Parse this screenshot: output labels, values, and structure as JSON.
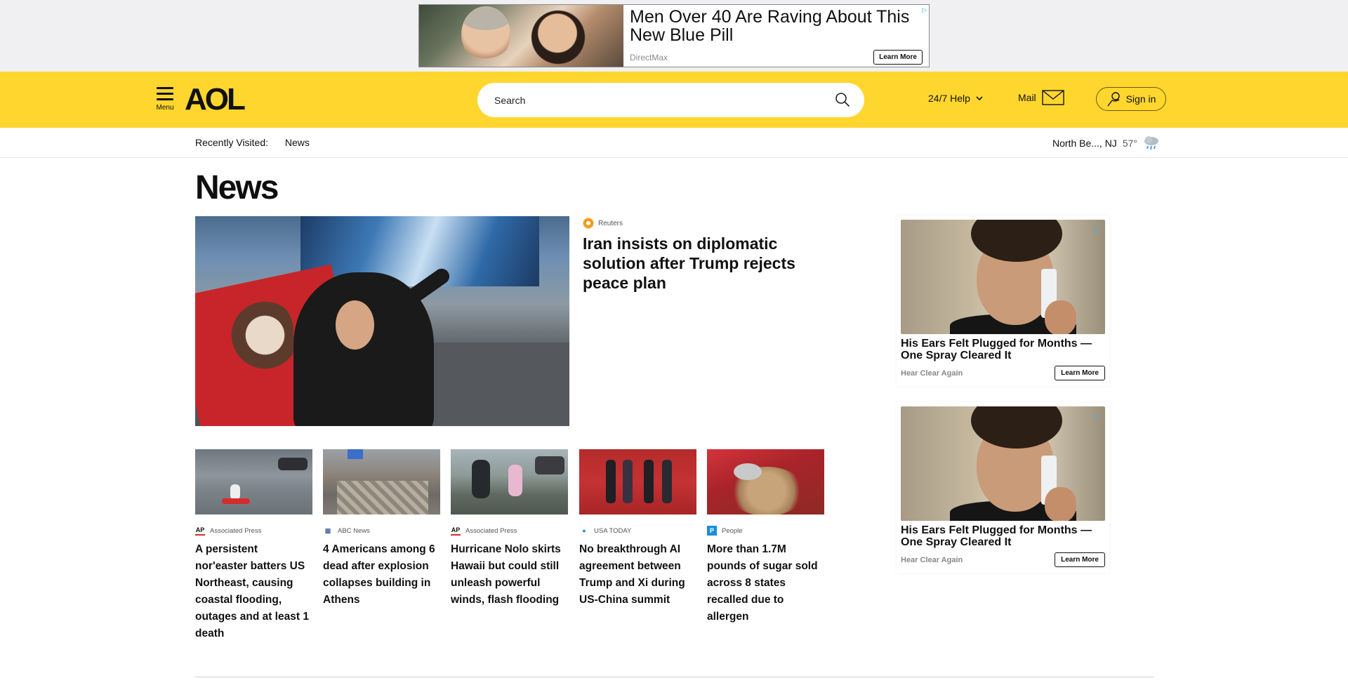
{
  "top_ad": {
    "headline": "Men Over 40 Are Raving About This New Blue Pill",
    "brand": "DirectMax",
    "cta": "Learn More"
  },
  "header": {
    "menu_label": "Menu",
    "logo": "AOL",
    "search_placeholder": "Search",
    "help_label": "24/7 Help",
    "mail_label": "Mail",
    "signin_label": "Sign in",
    "brand_color": "#ffd62e"
  },
  "subbar": {
    "recently_visited_label": "Recently Visited:",
    "recent_link": "News",
    "location": "North Be..., NJ",
    "temperature": "57°",
    "weather_icon": "rain-cloud-icon"
  },
  "main": {
    "page_title": "News",
    "hero": {
      "source": "Reuters",
      "title": "Iran insists on diplomatic solution after Trump rejects peace plan"
    },
    "cards": [
      {
        "source_badge": "AP",
        "source": "Associated Press",
        "title": "A persistent nor'easter batters US Northeast, causing coastal flooding, outages and at least 1 death"
      },
      {
        "source_badge": "▦",
        "source": "ABC News",
        "title": "4 Americans among 6 dead after explosion collapses building in Athens"
      },
      {
        "source_badge": "AP",
        "source": "Associated Press",
        "title": "Hurricane Nolo skirts Hawaii but could still unleash powerful winds, flash flooding"
      },
      {
        "source_badge": "●",
        "source": "USA TODAY",
        "title": "No breakthrough AI agreement between Trump and Xi during US-China summit"
      },
      {
        "source_badge": "P",
        "source": "People",
        "title": "More than 1.7M pounds of sugar sold across 8 states recalled due to allergen"
      }
    ]
  },
  "side_ads": [
    {
      "headline": "His Ears Felt Plugged for Months — One Spray Cleared It",
      "brand": "Hear Clear Again",
      "cta": "Learn More"
    },
    {
      "headline": "His Ears Felt Plugged for Months — One Spray Cleared It",
      "brand": "Hear Clear Again",
      "cta": "Learn More"
    }
  ]
}
